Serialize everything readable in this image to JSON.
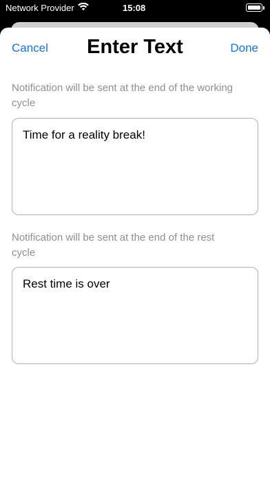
{
  "status_bar": {
    "carrier": "Network Provider",
    "time": "15:08",
    "battery_level": 1.0
  },
  "nav": {
    "cancel_label": "Cancel",
    "title": "Enter Text",
    "done_label": "Done"
  },
  "fields": [
    {
      "label": "Notification will be sent at the end of the working cycle",
      "value": "Time for a reality break!"
    },
    {
      "label": "Notification will be sent at the end of the rest cycle",
      "value": "Rest time is over"
    }
  ],
  "colors": {
    "accent": "#1a73c8",
    "label": "#8e8e93",
    "border": "#b0b0b4"
  }
}
